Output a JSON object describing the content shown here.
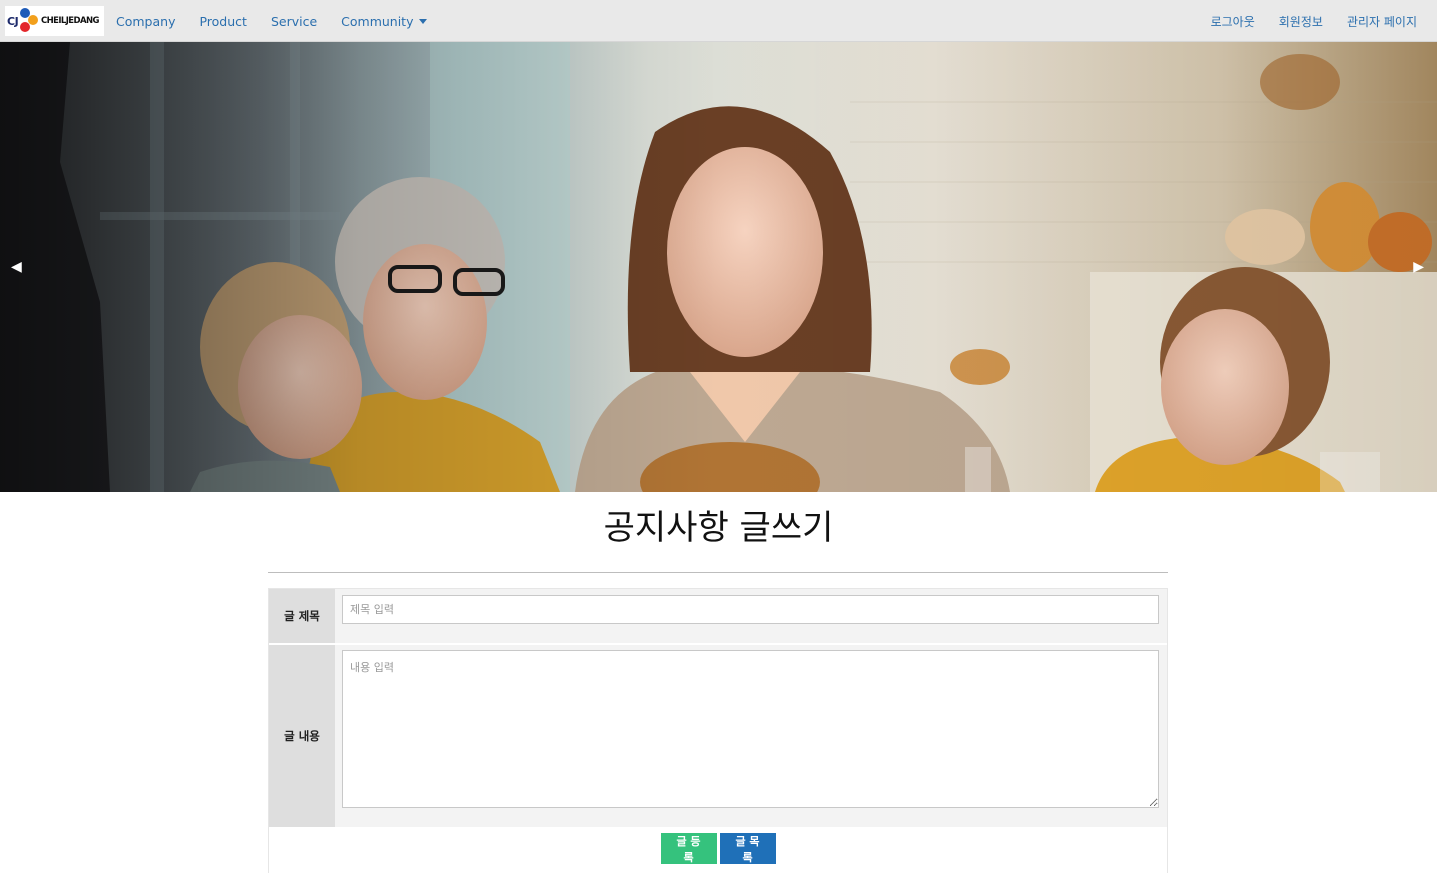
{
  "brand": {
    "logo_mark_text": "CJ",
    "logo_name_text": "CHEILJEDANG"
  },
  "nav": {
    "left": [
      {
        "label": "Company"
      },
      {
        "label": "Product"
      },
      {
        "label": "Service"
      },
      {
        "label": "Community",
        "has_dropdown": true
      }
    ],
    "right": [
      {
        "label": "로그아웃"
      },
      {
        "label": "회원정보"
      },
      {
        "label": "관리자 페이지"
      }
    ],
    "link_color": "#2b6fae",
    "bar_color": "#e9e9e9"
  },
  "carousel": {
    "prev_icon": "◀",
    "next_icon": "▶",
    "image_subject": "family-dinner-photo"
  },
  "page": {
    "title": "공지사항 글쓰기"
  },
  "form": {
    "title_label": "글 제목",
    "title_value": "",
    "title_placeholder": "제목 입력",
    "content_label": "글 내용",
    "content_value": "",
    "content_placeholder": "내용 입력",
    "submit_label": "글 등록",
    "list_label": "글 목록",
    "submit_color": "#35c27d",
    "list_color": "#1f70b8"
  }
}
